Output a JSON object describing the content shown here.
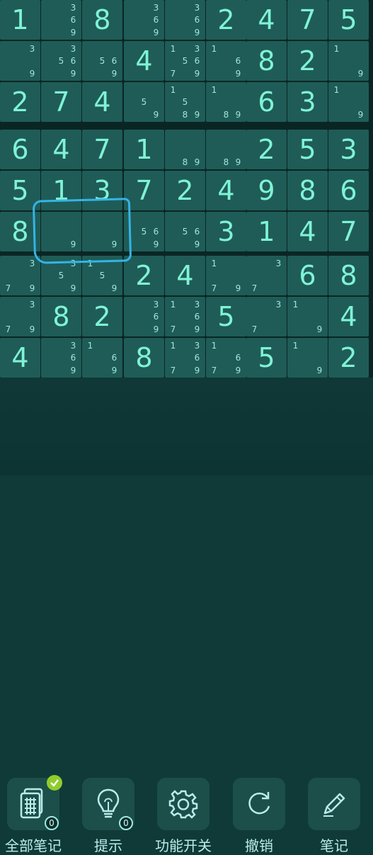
{
  "board": {
    "rows": [
      [
        {
          "v": "1"
        },
        {
          "n": [
            3,
            6,
            9
          ]
        },
        {
          "v": "8"
        },
        {
          "n": [
            3,
            6,
            9
          ]
        },
        {
          "n": [
            3,
            6,
            9
          ]
        },
        {
          "v": "2"
        },
        {
          "v": "4"
        },
        {
          "v": "7"
        },
        {
          "v": "5"
        }
      ],
      [
        {
          "n": [
            3,
            9
          ]
        },
        {
          "n": [
            3,
            5,
            6,
            9
          ]
        },
        {
          "n": [
            5,
            6,
            9
          ]
        },
        {
          "v": "4"
        },
        {
          "n": [
            1,
            3,
            5,
            6,
            7,
            9
          ]
        },
        {
          "n": [
            1,
            6,
            9
          ]
        },
        {
          "v": "8"
        },
        {
          "v": "2"
        },
        {
          "n": [
            1,
            9
          ]
        }
      ],
      [
        {
          "v": "2"
        },
        {
          "v": "7"
        },
        {
          "v": "4"
        },
        {
          "n": [
            5,
            9
          ]
        },
        {
          "n": [
            1,
            5,
            8,
            9
          ]
        },
        {
          "n": [
            1,
            8,
            9
          ]
        },
        {
          "v": "6"
        },
        {
          "v": "3"
        },
        {
          "n": [
            1,
            9
          ]
        }
      ],
      [
        {
          "v": "6"
        },
        {
          "v": "4"
        },
        {
          "v": "7"
        },
        {
          "v": "1"
        },
        {
          "n": [
            8,
            9
          ]
        },
        {
          "n": [
            8,
            9
          ]
        },
        {
          "v": "2"
        },
        {
          "v": "5"
        },
        {
          "v": "3"
        }
      ],
      [
        {
          "v": "5"
        },
        {
          "v": "1"
        },
        {
          "v": "3"
        },
        {
          "v": "7"
        },
        {
          "v": "2"
        },
        {
          "v": "4"
        },
        {
          "v": "9"
        },
        {
          "v": "8"
        },
        {
          "v": "6"
        }
      ],
      [
        {
          "v": "8"
        },
        {
          "n": [
            9
          ]
        },
        {
          "n": [
            9
          ]
        },
        {
          "n": [
            5,
            6,
            9
          ]
        },
        {
          "n": [
            5,
            6,
            9
          ]
        },
        {
          "v": "3"
        },
        {
          "v": "1"
        },
        {
          "v": "4"
        },
        {
          "v": "7"
        }
      ],
      [
        {
          "n": [
            3,
            7,
            9
          ]
        },
        {
          "n": [
            3,
            5,
            9
          ]
        },
        {
          "n": [
            1,
            5,
            9
          ]
        },
        {
          "v": "2"
        },
        {
          "v": "4"
        },
        {
          "n": [
            1,
            7,
            9
          ]
        },
        {
          "n": [
            3,
            7
          ]
        },
        {
          "v": "6"
        },
        {
          "v": "8"
        }
      ],
      [
        {
          "n": [
            3,
            7,
            9
          ]
        },
        {
          "v": "8"
        },
        {
          "v": "2"
        },
        {
          "n": [
            3,
            6,
            9
          ]
        },
        {
          "n": [
            1,
            3,
            6,
            7,
            9
          ]
        },
        {
          "v": "5"
        },
        {
          "n": [
            3,
            7
          ]
        },
        {
          "n": [
            1,
            9
          ]
        },
        {
          "v": "4"
        }
      ],
      [
        {
          "v": "4"
        },
        {
          "n": [
            3,
            6,
            9
          ]
        },
        {
          "n": [
            1,
            6,
            9
          ]
        },
        {
          "v": "8"
        },
        {
          "n": [
            1,
            3,
            6,
            7,
            9
          ]
        },
        {
          "n": [
            1,
            6,
            7,
            9
          ]
        },
        {
          "v": "5"
        },
        {
          "n": [
            1,
            9
          ]
        },
        {
          "v": "2"
        }
      ]
    ]
  },
  "toolbar": [
    {
      "name": "all-notes",
      "label": "全部笔记",
      "icon": "notes-grid-icon",
      "badge": "0",
      "checked": true
    },
    {
      "name": "hint",
      "label": "提示",
      "icon": "lightbulb-icon",
      "badge": "0"
    },
    {
      "name": "features-toggle",
      "label": "功能开关",
      "icon": "gear-icon"
    },
    {
      "name": "undo",
      "label": "撤销",
      "icon": "undo-icon"
    },
    {
      "name": "notes",
      "label": "笔记",
      "icon": "pencil-icon"
    }
  ],
  "colors": {
    "digit": "#7ff3d6",
    "cell": "#1f5c57",
    "highlight": "#34b4e6",
    "check": "#8fcc2c"
  }
}
